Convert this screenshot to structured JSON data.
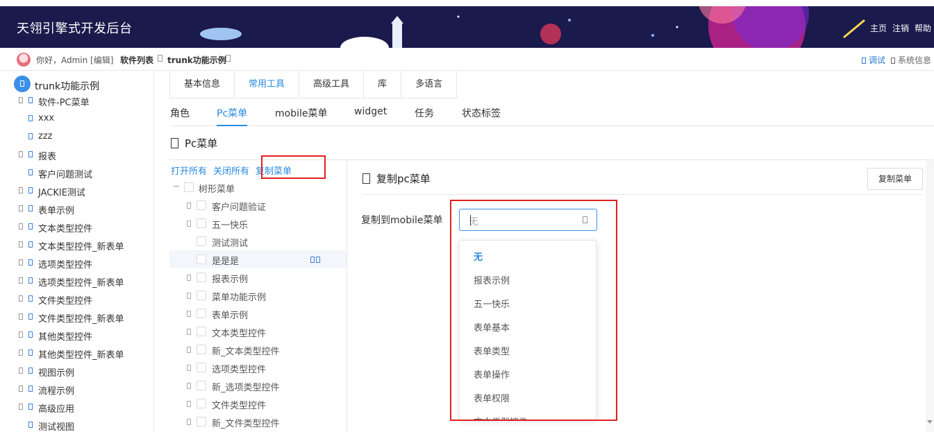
{
  "app": {
    "title": "天翎引擎式开发后台",
    "nav_links": [
      "主页",
      "注销",
      "帮助"
    ]
  },
  "userbar": {
    "greeting": "你好，Admin [编辑]",
    "breadcrumb": [
      "软件列表",
      "trunk功能示例"
    ],
    "debug": "调试",
    "system_info": "系统信息"
  },
  "sidebar": {
    "root_label": "trunk功能示例",
    "items": [
      {
        "label": "软件-PC菜单",
        "expandable": true
      },
      {
        "label": "xxx",
        "expandable": false
      },
      {
        "label": "zzz",
        "expandable": false
      },
      {
        "label": "报表",
        "expandable": true
      },
      {
        "label": "客户问题测试",
        "expandable": false
      },
      {
        "label": "JACKIE测试",
        "expandable": true
      },
      {
        "label": "表单示例",
        "expandable": true
      },
      {
        "label": "文本类型控件",
        "expandable": true
      },
      {
        "label": "文本类型控件_新表单",
        "expandable": true
      },
      {
        "label": "选项类型控件",
        "expandable": true
      },
      {
        "label": "选项类型控件_新表单",
        "expandable": true
      },
      {
        "label": "文件类型控件",
        "expandable": true
      },
      {
        "label": "文件类型控件_新表单",
        "expandable": true
      },
      {
        "label": "其他类型控件",
        "expandable": true
      },
      {
        "label": "其他类型控件_新表单",
        "expandable": true
      },
      {
        "label": "视图示例",
        "expandable": true
      },
      {
        "label": "流程示例",
        "expandable": true
      },
      {
        "label": "高级应用",
        "expandable": true
      },
      {
        "label": "测试视图",
        "expandable": false
      }
    ]
  },
  "tabs_primary": {
    "items": [
      "基本信息",
      "常用工具",
      "高级工具",
      "库",
      "多语言"
    ],
    "active": "常用工具"
  },
  "tabs_secondary": {
    "items": [
      "角色",
      "Pc菜单",
      "mobile菜单",
      "widget",
      "任务",
      "状态标签"
    ],
    "active": "Pc菜单"
  },
  "section": {
    "title": "Pc菜单"
  },
  "tree": {
    "actions": {
      "open_all": "打开所有",
      "close_all": "关闭所有",
      "copy_menu": "复制菜单"
    },
    "root": "树形菜单",
    "nodes": [
      {
        "label": "客户问题验证",
        "expandable": true
      },
      {
        "label": "五一快乐",
        "expandable": true
      },
      {
        "label": "测试测试",
        "expandable": false
      },
      {
        "label": "是是是",
        "expandable": false,
        "highlighted": true
      },
      {
        "label": "报表示例",
        "expandable": true
      },
      {
        "label": "菜单功能示例",
        "expandable": true
      },
      {
        "label": "表单示例",
        "expandable": true
      },
      {
        "label": "文本类型控件",
        "expandable": true
      },
      {
        "label": "新_文本类型控件",
        "expandable": true
      },
      {
        "label": "选项类型控件",
        "expandable": true
      },
      {
        "label": "新_选项类型控件",
        "expandable": true
      },
      {
        "label": "文件类型控件",
        "expandable": true
      },
      {
        "label": "新_文件类型控件",
        "expandable": true
      }
    ]
  },
  "copy_form": {
    "title": "复制pc菜单",
    "button": "复制菜单",
    "field_label": "复制到mobile菜单",
    "select_value": "无",
    "options": [
      "无",
      "报表示例",
      "五一快乐",
      "表单基本",
      "表单类型",
      "表单操作",
      "表单权限",
      "文本类型控件"
    ],
    "selected_option": "无"
  },
  "colors": {
    "header_bg": "#1b1a4d",
    "accent": "#2a8ae0",
    "highlight_box": "#e02020"
  }
}
